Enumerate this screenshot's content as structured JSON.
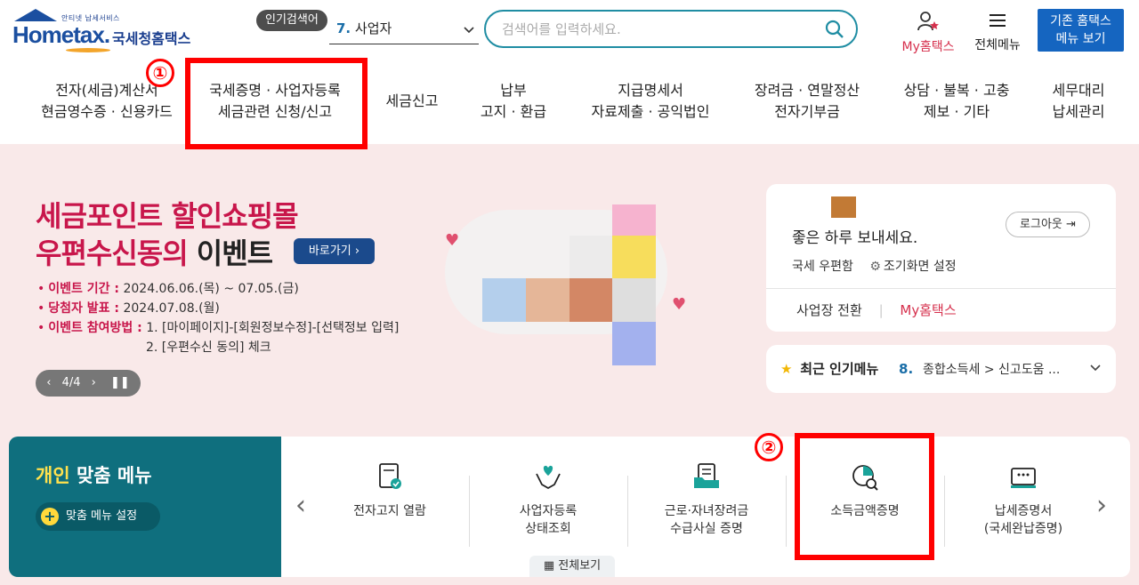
{
  "header": {
    "logo_sub": "안티넷 납세서비스",
    "logo_main": "Hometax.",
    "logo_kr": "국세청홈택스",
    "popular_label": "인기검색어",
    "popular_num": "7.",
    "popular_text": "사업자",
    "search_placeholder": "검색어를 입력하세요.",
    "my_hometax": "My홈택스",
    "all_menu": "전체메뉴",
    "old_hometax_line1": "기존 홈택스",
    "old_hometax_line2": "메뉴 보기"
  },
  "gnb": [
    {
      "line1": "전자(세금)계산서",
      "line2": "현금영수증 · 신용카드"
    },
    {
      "line1": "국세증명 · 사업자등록",
      "line2": "세금관련 신청/신고"
    },
    {
      "line1": "세금신고",
      "line2": ""
    },
    {
      "line1": "납부",
      "line2": "고지 · 환급"
    },
    {
      "line1": "지급명세서",
      "line2": "자료제출 · 공익법인"
    },
    {
      "line1": "장려금 · 연말정산",
      "line2": "전자기부금"
    },
    {
      "line1": "상담 · 불복 · 고충",
      "line2": "제보 · 기타"
    },
    {
      "line1": "세무대리",
      "line2": "납세관리"
    }
  ],
  "annotations": {
    "one": "①",
    "two": "②"
  },
  "banner": {
    "title_line1": "세금포인트 할인쇼핑몰",
    "title_line2_red": "우편수신동의",
    "title_line2_dark": "이벤트",
    "go_button": "바로가기",
    "event_period_key": "이벤트 기간 :",
    "event_period_val": "2024.06.06.(목) ~ 07.05.(금)",
    "winner_key": "당첨자 발표 :",
    "winner_val": "2024.07.08.(월)",
    "method_key": "이벤트 참여방법 :",
    "method_val1": "1. [마이페이지]-[회원정보수정]-[선택정보 입력]",
    "method_val2": "2. [우편수신 동의] 체크",
    "slide_counter": "4/4"
  },
  "user_card": {
    "greeting": "좋은 하루 보내세요.",
    "logout": "로그아웃",
    "postbox": "국세 우편함",
    "initial_setting": "조기화면 설정",
    "switch_business": "사업장 전환",
    "my_hometax": "My홈택스"
  },
  "recent_menu": {
    "title": "최근 인기메뉴",
    "num": "8.",
    "text": "종합소득세 > 신고도움 ..."
  },
  "custom_menu": {
    "title_hl": "개인",
    "title_rest": "맞춤 메뉴",
    "setting": "맞춤 메뉴 설정",
    "items": [
      {
        "line1": "전자고지 열람",
        "line2": ""
      },
      {
        "line1": "사업자등록",
        "line2": "상태조회"
      },
      {
        "line1": "근로·자녀장려금",
        "line2": "수급사실 증명"
      },
      {
        "line1": "소득금액증명",
        "line2": ""
      },
      {
        "line1": "납세증명서",
        "line2": "(국세완납증명)"
      }
    ],
    "all_view": "전체보기"
  },
  "colors": {
    "accent": "#1565c0",
    "teal": "#0f6f7e",
    "brand_red": "#c8164b",
    "highlight_red": "#ff0000"
  }
}
